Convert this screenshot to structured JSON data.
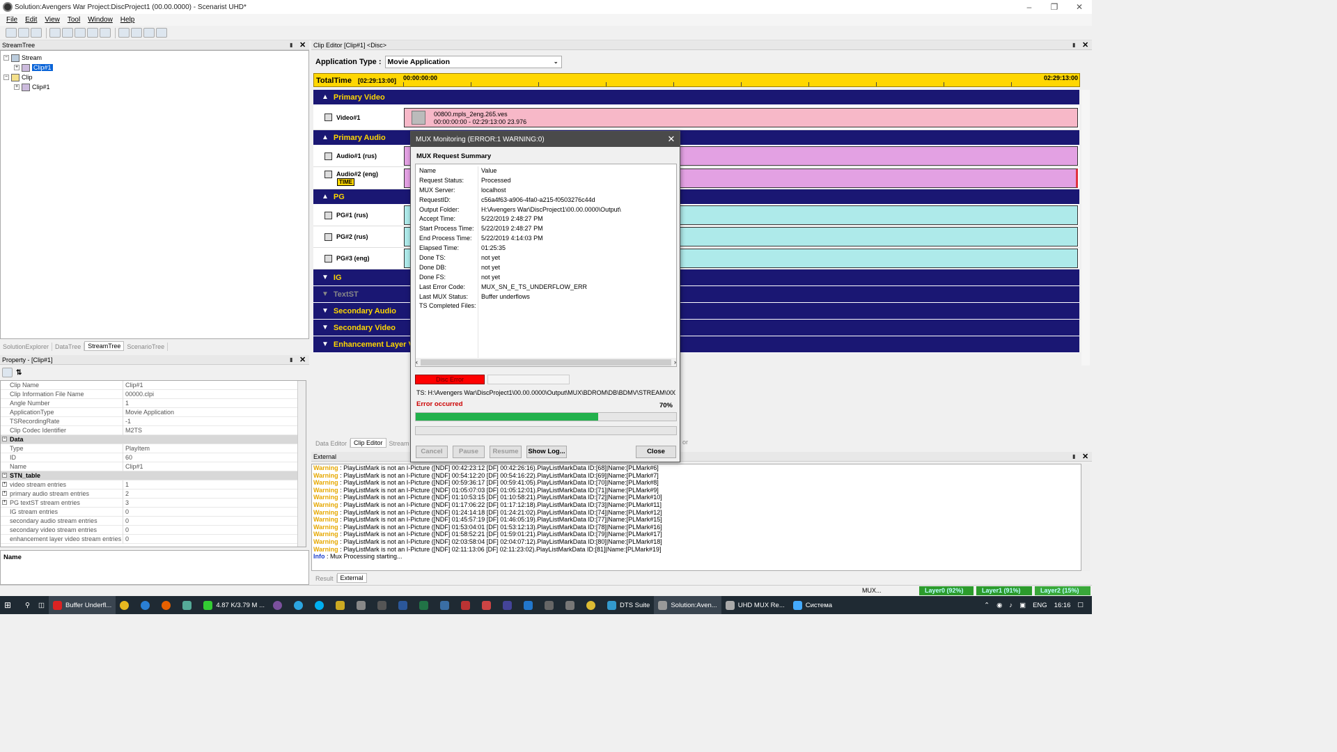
{
  "window": {
    "title": "Solution:Avengers War  Project:DiscProject1 (00.00.0000) - Scenarist UHD*"
  },
  "menu": [
    "File",
    "Edit",
    "View",
    "Tool",
    "Window",
    "Help"
  ],
  "streamtree": {
    "header": "StreamTree",
    "nodes": [
      "Stream",
      "Clip#1",
      "Clip",
      "Clip#1"
    ],
    "tabs": [
      "SolutionExplorer",
      "DataTree",
      "StreamTree",
      "ScenarioTree"
    ]
  },
  "property": {
    "header": "Property - [Clip#1]",
    "rows": [
      {
        "k": "Clip Name",
        "v": "Clip#1"
      },
      {
        "k": "Clip Information File Name",
        "v": "00000.clpi"
      },
      {
        "k": "Angle Number",
        "v": "1"
      },
      {
        "k": "ApplicationType",
        "v": "Movie Application"
      },
      {
        "k": "TSRecordingRate",
        "v": "-1"
      },
      {
        "k": "Clip Codec Identifier",
        "v": "M2TS"
      }
    ],
    "data_cat": "Data",
    "data_rows": [
      {
        "k": "Type",
        "v": "PlayItem"
      },
      {
        "k": "ID",
        "v": "60"
      },
      {
        "k": "Name",
        "v": "Clip#1"
      }
    ],
    "stn_cat": "STN_table",
    "stn_rows": [
      {
        "k": "video stream entries",
        "v": "1"
      },
      {
        "k": "primary audio stream entries",
        "v": "2"
      },
      {
        "k": "PG textST stream entries",
        "v": "3"
      },
      {
        "k": "IG stream entries",
        "v": "0"
      },
      {
        "k": "secondary audio stream entries",
        "v": "0"
      },
      {
        "k": "secondary video stream entries",
        "v": "0"
      },
      {
        "k": "enhancement layer video stream entries",
        "v": "0"
      }
    ],
    "desc_title": "Name"
  },
  "clip_editor": {
    "header": "Clip Editor [Clip#1] <Disc>",
    "app_type_label": "Application Type :",
    "app_type_value": "Movie Application",
    "total_time_label": "TotalTime",
    "total_time_value": "[02:29:13:00]",
    "time_start": "00:00:00:00",
    "time_end": "02:29:13:00",
    "sections": {
      "primary_video": "Primary Video",
      "primary_audio": "Primary Audio",
      "pg": "PG",
      "ig": "IG",
      "textst": "TextST",
      "secondary_audio": "Secondary Audio",
      "secondary_video": "Secondary Video",
      "enhancement": "Enhancement Layer V"
    },
    "video_track": "Video#1",
    "video_file": "00800.mpls_2eng.265.ves",
    "video_info": "00:00:00:00 - 02:29:13:00  23.976",
    "audio1": "Audio#1 (rus)",
    "audio2": "Audio#2 (eng)",
    "time_badge": "TIME",
    "pg1": "PG#1 (rus)",
    "pg2": "PG#2 (rus)",
    "pg3": "PG#3 (eng)",
    "tabs": [
      "Data Editor",
      "Clip Editor",
      "Stream E"
    ],
    "tab_tail": "or"
  },
  "dialog": {
    "title": "MUX Monitoring  (ERROR:1 WARNING:0)",
    "section": "MUX Request Summary",
    "col_name": "Name",
    "col_value": "Value",
    "rows": [
      {
        "k": "Request Status:",
        "v": "Processed"
      },
      {
        "k": "MUX Server:",
        "v": "localhost"
      },
      {
        "k": "RequestID:",
        "v": "c56a4f63-a906-4fa0-a215-f0503276c44d"
      },
      {
        "k": "Output Folder:",
        "v": "H:\\Avengers War\\DiscProject1\\00.00.0000\\Output\\"
      },
      {
        "k": "Accept Time:",
        "v": "5/22/2019 2:48:27 PM"
      },
      {
        "k": "Start Process Time:",
        "v": "5/22/2019 2:48:27 PM"
      },
      {
        "k": "End Process Time:",
        "v": "5/22/2019 4:14:03 PM"
      },
      {
        "k": "Elapsed Time:",
        "v": "01:25:35"
      },
      {
        "k": "Done TS:",
        "v": "not yet"
      },
      {
        "k": "Done DB:",
        "v": "not yet"
      },
      {
        "k": "Done FS:",
        "v": "not yet"
      },
      {
        "k": "Last Error Code:",
        "v": "MUX_SN_E_TS_UNDERFLOW_ERR"
      },
      {
        "k": "Last MUX Status:",
        "v": "Buffer underflows"
      },
      {
        "k": "TS Completed Files:",
        "v": ""
      }
    ],
    "disc_error": "Disc Error",
    "ts_path": "TS: H:\\Avengers War\\DiscProject1\\00.00.0000\\Output\\MUX\\BDROM\\DB\\BDMV\\STREAM\\000",
    "error_text": "Error occurred",
    "progress_label": "70%",
    "progress": 0.7,
    "buttons": {
      "cancel": "Cancel",
      "pause": "Pause",
      "resume": "Resume",
      "showlog": "Show Log...",
      "close": "Close"
    }
  },
  "external": {
    "header": "External",
    "lines": [
      {
        "t": "Warning",
        "m": " : PlayListMark is not an I-Picture ([NDF] 00:42:23:12  [DF] 00:42:26:16).PlayListMarkData ID:[68]|Name:[PLMark#6]"
      },
      {
        "t": "Warning",
        "m": " : PlayListMark is not an I-Picture ([NDF] 00:54:12:20  [DF] 00:54:16:22).PlayListMarkData ID:[69]|Name:[PLMark#7]"
      },
      {
        "t": "Warning",
        "m": " : PlayListMark is not an I-Picture ([NDF] 00:59:36:17  [DF] 00:59:41:05).PlayListMarkData ID:[70]|Name:[PLMark#8]"
      },
      {
        "t": "Warning",
        "m": " : PlayListMark is not an I-Picture ([NDF] 01:05:07:03  [DF] 01:05:12:01).PlayListMarkData ID:[71]|Name:[PLMark#9]"
      },
      {
        "t": "Warning",
        "m": " : PlayListMark is not an I-Picture ([NDF] 01:10:53:15  [DF] 01:10:58:21).PlayListMarkData ID:[72]|Name:[PLMark#10]"
      },
      {
        "t": "Warning",
        "m": " : PlayListMark is not an I-Picture ([NDF] 01:17:06:22  [DF] 01:17:12:18).PlayListMarkData ID:[73]|Name:[PLMark#11]"
      },
      {
        "t": "Warning",
        "m": " : PlayListMark is not an I-Picture ([NDF] 01:24:14:18  [DF] 01:24:21:02).PlayListMarkData ID:[74]|Name:[PLMark#12]"
      },
      {
        "t": "Warning",
        "m": " : PlayListMark is not an I-Picture ([NDF] 01:45:57:19  [DF] 01:46:05:19).PlayListMarkData ID:[77]|Name:[PLMark#15]"
      },
      {
        "t": "Warning",
        "m": " : PlayListMark is not an I-Picture ([NDF] 01:53:04:01  [DF] 01:53:12:13).PlayListMarkData ID:[78]|Name:[PLMark#16]"
      },
      {
        "t": "Warning",
        "m": " : PlayListMark is not an I-Picture ([NDF] 01:58:52:21  [DF] 01:59:01:21).PlayListMarkData ID:[79]|Name:[PLMark#17]"
      },
      {
        "t": "Warning",
        "m": " : PlayListMark is not an I-Picture ([NDF] 02:03:58:04  [DF] 02:04:07:12).PlayListMarkData ID:[80]|Name:[PLMark#18]"
      },
      {
        "t": "Warning",
        "m": " : PlayListMark is not an I-Picture ([NDF] 02:11:13:06  [DF] 02:11:23:02).PlayListMarkData ID:[81]|Name:[PLMark#19]"
      },
      {
        "t": "Info",
        "m": " : Mux Processing starting..."
      }
    ],
    "tabs": [
      "Result",
      "External"
    ]
  },
  "status": {
    "mux": "MUX...",
    "layer0": "Layer0 (92%)",
    "layer1": "Layer1 (91%)",
    "layer2": "Layer2 (15%)"
  },
  "taskbar": {
    "items": [
      "Buffer Underfl...",
      "4.87 K/3.79 M ...",
      "DTS Suite",
      "Solution:Aven...",
      "UHD MUX Re...",
      "Система"
    ],
    "lang": "ENG",
    "time": "16:16"
  },
  "colors": {
    "section_bg": "#1a1773",
    "section_text": "#ffd700",
    "video_bar": "#f7b8c8",
    "audio_bar": "#e3a1e3",
    "pg_bar": "#aeeaea",
    "error": "#ff0000",
    "progress": "#22b14c"
  }
}
